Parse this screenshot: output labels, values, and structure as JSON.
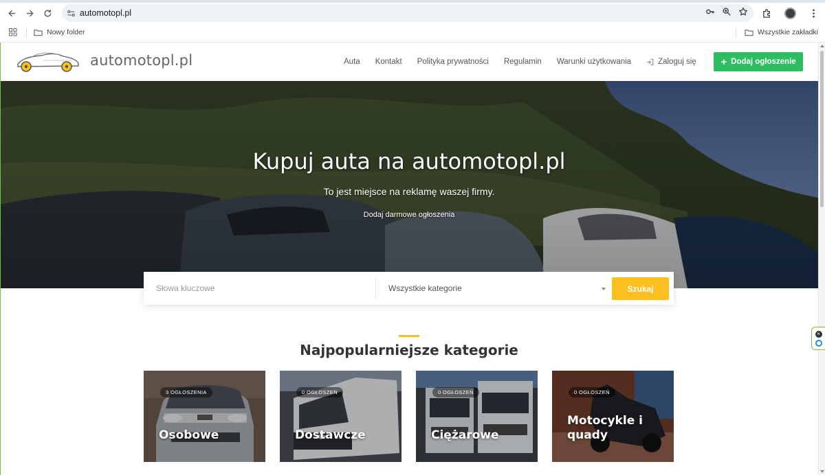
{
  "browser": {
    "url": "automotopl.pl",
    "bookmarks": {
      "folder_label": "Nowy folder",
      "all_bookmarks_label": "Wszystkie zakładki"
    }
  },
  "header": {
    "brand": "automotopl.pl",
    "nav": [
      {
        "label": "Auta"
      },
      {
        "label": "Kontakt"
      },
      {
        "label": "Polityka prywatności"
      },
      {
        "label": "Regulamin"
      },
      {
        "label": "Warunki użytkowania"
      }
    ],
    "login_label": "Zaloguj się",
    "add_button_label": "Dodaj ogłoszenie",
    "add_button_color": "#2ebd60"
  },
  "hero": {
    "title": "Kupuj auta na automotopl.pl",
    "subtitle": "To jest miejsce na reklamę waszej firmy.",
    "link": "Dodaj darmowe ogłoszenia"
  },
  "search": {
    "keywords_placeholder": "Słowa kluczowe",
    "category_value": "Wszystkie kategorie",
    "button_label": "Szukaj",
    "button_color": "#fbbf1f"
  },
  "categories": {
    "title": "Najpopularniejsze kategorie",
    "items": [
      {
        "badge": "3 OGŁOSZENIA",
        "name": "Osobowe"
      },
      {
        "badge": "0 OGŁOSZEŃ",
        "name": "Dostawcze"
      },
      {
        "badge": "0 OGŁOSZEŃ",
        "name": "Ciężarowe"
      },
      {
        "badge": "0 OGŁOSZEŃ",
        "name": "Motocykle i quady"
      }
    ]
  }
}
